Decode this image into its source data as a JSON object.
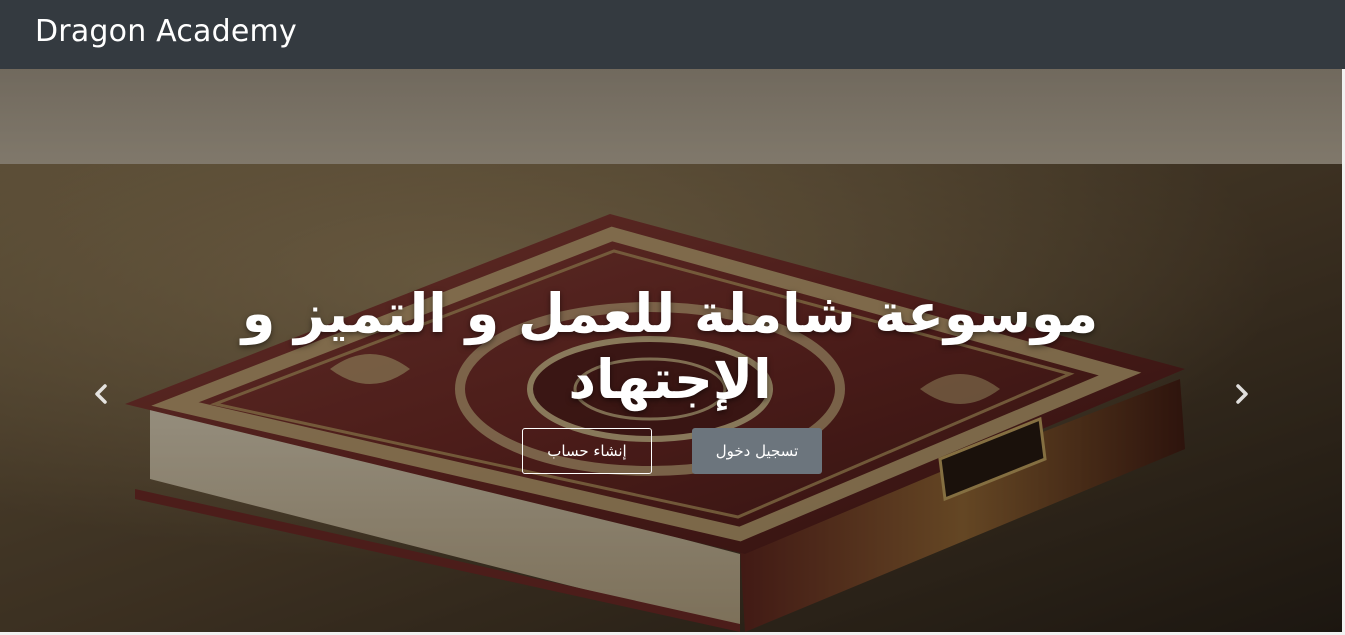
{
  "navbar": {
    "brand": "Dragon Academy"
  },
  "hero": {
    "headline": "موسوعة شاملة للعمل و التميز و الإجتهاد",
    "buttons": {
      "login_label": "تسجيل دخول",
      "register_label": "إنشاء حساب"
    },
    "carousel": {
      "prev_icon": "chevron-left-icon",
      "next_icon": "chevron-right-icon"
    }
  },
  "colors": {
    "navbar_bg": "#343a40",
    "button_secondary": "#6c757d",
    "text_on_dark": "#ffffff"
  }
}
